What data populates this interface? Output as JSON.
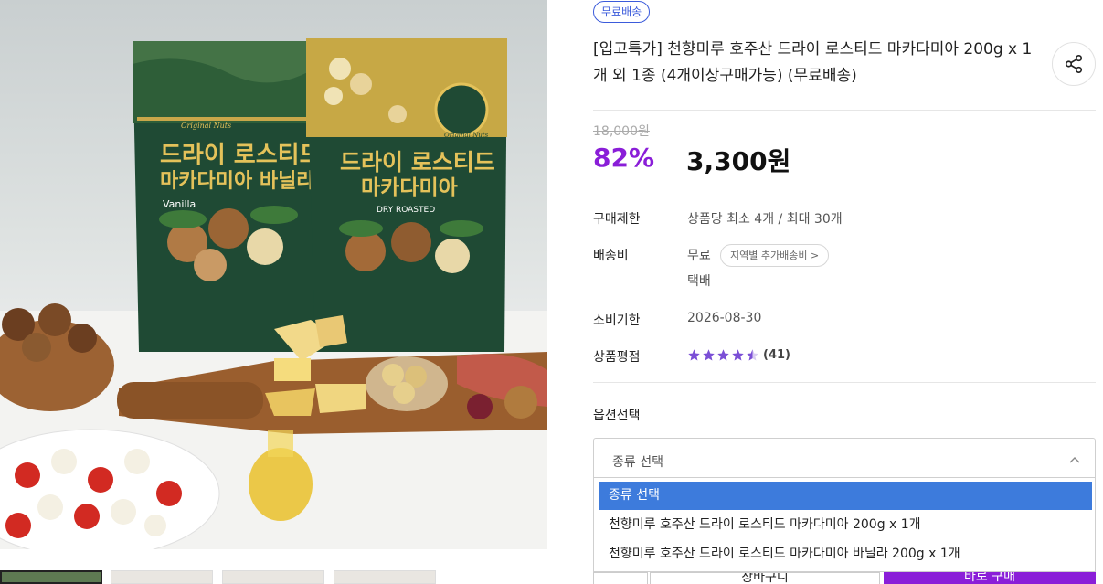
{
  "product": {
    "badge": "무료배송",
    "title": "[입고특가] 천향미루 호주산 드라이 로스티드 마카다미아 200g x 1개 외 1종 (4개이상구매가능) (무료배송)",
    "original_price": "18,000원",
    "discount": "82%",
    "price": "3,300원"
  },
  "photo": {
    "bag_left": {
      "line1": "드라이 로스티드",
      "line2": "마카다미아 바닐라",
      "flavor": "Vanilla",
      "brand_tag": "Original Nuts"
    },
    "bag_right": {
      "line1": "드라이 로스티드",
      "line2": "마카다미아",
      "flavor": "DRY ROASTED",
      "brand_tag": "Original Nuts"
    }
  },
  "info": {
    "limit_label": "구매제한",
    "limit_value": "상품당 최소 4개 / 최대 30개",
    "shipping_label": "배송비",
    "shipping_value": "무료",
    "region_button": "지역별 추가배송비 >",
    "shipping_method": "택배",
    "expiry_label": "소비기한",
    "expiry_value": "2026-08-30",
    "rating_label": "상품평점",
    "rating": 4.5,
    "review_count": "(41)"
  },
  "options": {
    "label": "옵션선택",
    "select_value": "종류 선택",
    "items": [
      "종류 선택",
      "천향미루 호주산 드라이 로스티드 마카다미아 200g x 1개",
      "천향미루 호주산 드라이 로스티드 마카다미아 바닐라 200g x 1개"
    ]
  },
  "actions": {
    "cart": "장바구니",
    "buy": "바로 구매"
  },
  "colors": {
    "accent": "#8a1ed8",
    "badge": "#3b5bdb",
    "selected": "#3d7bdc",
    "bag_green": "#1f4a34",
    "bag_gold": "#e4c25a"
  },
  "icons": {
    "share": "share-icon",
    "chevron": "chevron-up-icon",
    "star": "star-icon"
  }
}
